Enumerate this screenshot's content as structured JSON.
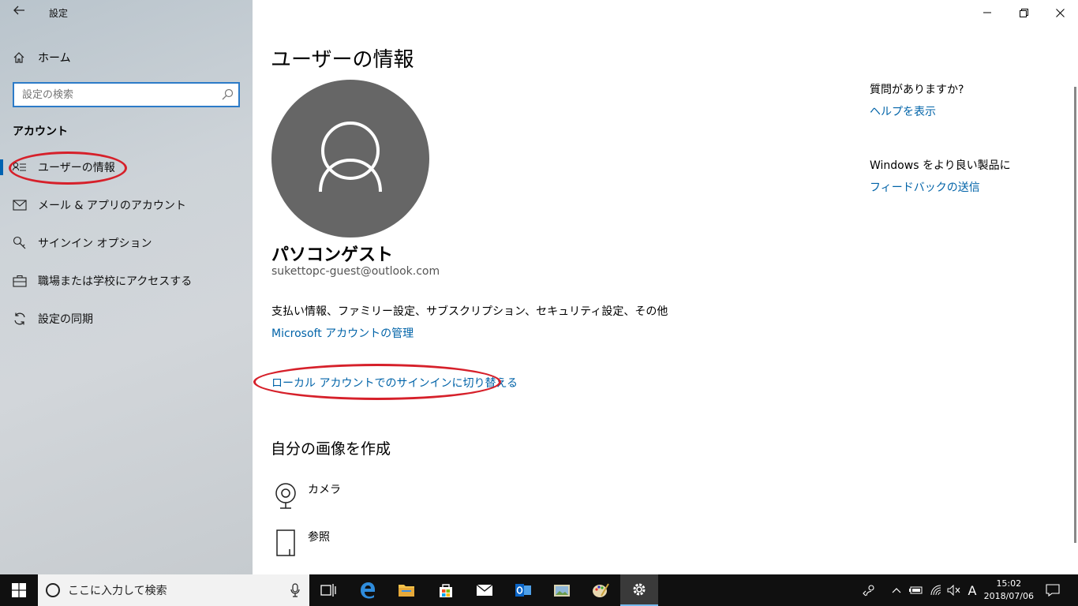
{
  "window": {
    "title": "設定"
  },
  "sidebar": {
    "home_label": "ホーム",
    "search_placeholder": "設定の検索",
    "section_title": "アカウント",
    "items": [
      {
        "label": "ユーザーの情報",
        "icon": "user-info-icon",
        "active": true
      },
      {
        "label": "メール & アプリのアカウント",
        "icon": "mail-icon"
      },
      {
        "label": "サインイン オプション",
        "icon": "key-icon"
      },
      {
        "label": "職場または学校にアクセスする",
        "icon": "briefcase-icon"
      },
      {
        "label": "設定の同期",
        "icon": "sync-icon"
      }
    ]
  },
  "main": {
    "title": "ユーザーの情報",
    "user_name": "パソコンゲスト",
    "user_email": "sukettopc-guest@outlook.com",
    "account_desc": "支払い情報、ファミリー設定、サブスクリプション、セキュリティ設定、その他",
    "manage_link": "Microsoft アカウントの管理",
    "switch_local_link": "ローカル アカウントでのサインインに切り替える",
    "create_picture_heading": "自分の画像を作成",
    "picture_options": [
      {
        "label": "カメラ",
        "icon": "camera-icon"
      },
      {
        "label": "参照",
        "icon": "browse-icon"
      }
    ]
  },
  "help": {
    "question": "質問がありますか?",
    "help_link": "ヘルプを表示",
    "feedback_title": "Windows をより良い製品に",
    "feedback_link": "フィードバックの送信"
  },
  "taskbar": {
    "search_placeholder": "ここに入力して検索",
    "ime_indicator": "A",
    "time": "15:02",
    "date": "2018/07/06"
  },
  "colors": {
    "accent": "#0063b1",
    "link": "#0063a8",
    "annotation_red": "#d6202a",
    "taskbar": "#101010"
  }
}
